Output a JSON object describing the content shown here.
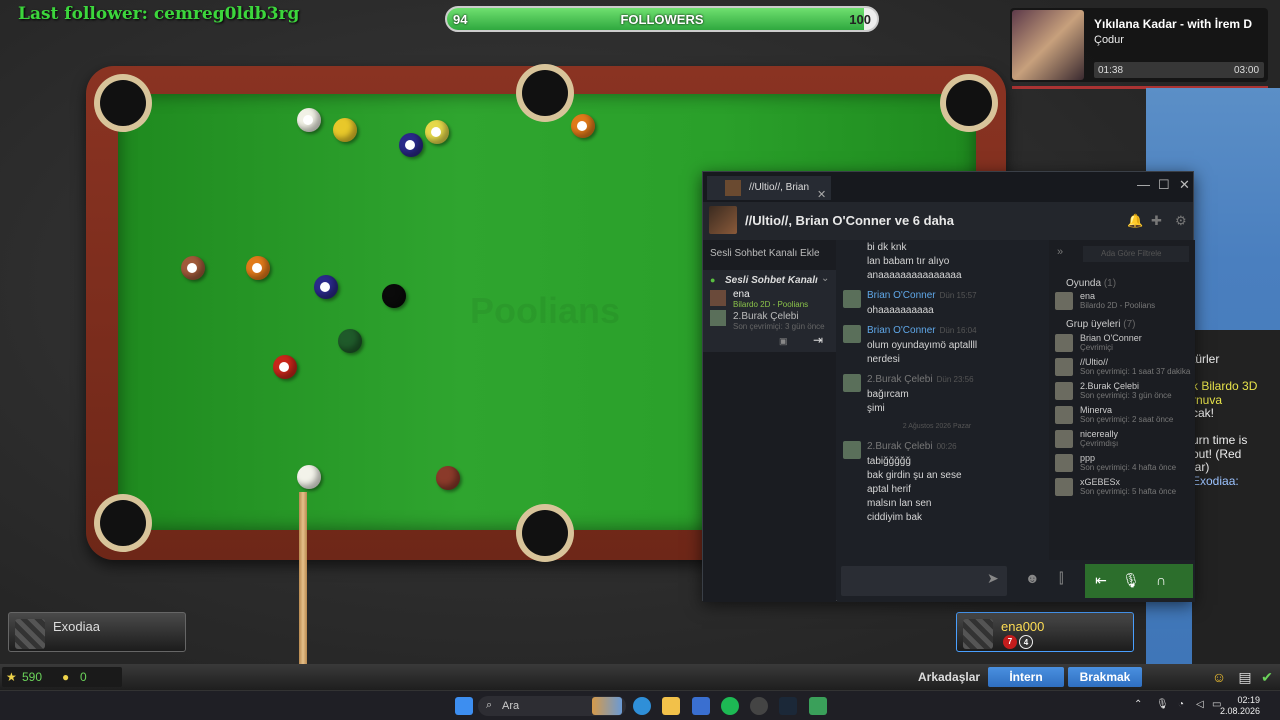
{
  "overlay": {
    "last_follower": "Last follower: cemreg0ldb3rg",
    "followers": {
      "min": "94",
      "label": "FOLLOWERS",
      "max": "100",
      "progress_fraction": 0.97
    }
  },
  "spotify": {
    "title": "Yıkılana Kadar - with İrem D",
    "artist": "Çodur",
    "elapsed": "01:38",
    "total": "03:00"
  },
  "table": {
    "watermark": "Poolians"
  },
  "players": {
    "left": {
      "name": "Exodiaa"
    },
    "right": {
      "name": "ena000",
      "chip1": "7",
      "chip2": "4"
    }
  },
  "gamebar": {
    "stars": "590",
    "coins": "0",
    "friends_label": "Arkadaşlar",
    "intern_button": "İntern",
    "quit_button": "Brakmak"
  },
  "stream_chat": {
    "lines": [
      {
        "text": "türler",
        "color": "w"
      },
      {
        "text": "]",
        "color": "g"
      },
      {
        "text": "k Bilardo 3D",
        "color": "y"
      },
      {
        "text": "rnuva",
        "color": "y"
      },
      {
        "text": "cak!",
        "color": "w"
      },
      {
        "text": "]",
        "color": "g"
      },
      {
        "text": "urn time is",
        "color": "w"
      },
      {
        "text": "out! (Red",
        "color": "w"
      },
      {
        "text": "lar)",
        "color": "w"
      },
      {
        "text": "Exodiaa:",
        "color": "b"
      }
    ]
  },
  "steam": {
    "tab_label": "//Ultio//, Brian",
    "header_title": "//Ultio//, Brian O'Conner ve 6 daha",
    "left": {
      "add_voice": "Sesli Sohbet Kanalı Ekle",
      "voice_channel": "Sesli Sohbet Kanalı",
      "users": [
        {
          "name": "ena",
          "status": "Bilardo 2D - Poolians"
        },
        {
          "name": "2.Burak Çelebi",
          "status": "Son çevrimiçi: 3 gün önce"
        }
      ]
    },
    "messages": [
      {
        "type": "line",
        "text": "bi dk knk"
      },
      {
        "type": "line",
        "text": "lan babam tır alıyo"
      },
      {
        "type": "line",
        "text": "anaaaaaaaaaaaaaaa"
      },
      {
        "type": "author",
        "name": "Brian O'Conner",
        "time": "Dün 15:57",
        "color": "blue"
      },
      {
        "type": "line",
        "text": "ohaaaaaaaaaa"
      },
      {
        "type": "author",
        "name": "Brian O'Conner",
        "time": "Dün 16:04",
        "color": "blue"
      },
      {
        "type": "line",
        "text": "olum oyundayımö aptallll"
      },
      {
        "type": "line",
        "text": "nerdesi"
      },
      {
        "type": "author",
        "name": "2.Burak Çelebi",
        "time": "Dün 23:56",
        "color": "gray"
      },
      {
        "type": "line",
        "text": "bağırcam"
      },
      {
        "type": "line",
        "text": "şimi"
      },
      {
        "type": "date",
        "text": "2 Ağustos 2026 Pazar"
      },
      {
        "type": "author",
        "name": "2.Burak Çelebi",
        "time": "00:26",
        "color": "gray"
      },
      {
        "type": "line",
        "text": "tabiğğğğğ"
      },
      {
        "type": "line",
        "text": "bak girdin şu an sese"
      },
      {
        "type": "line",
        "text": "aptal herif"
      },
      {
        "type": "line",
        "text": "malsın lan sen"
      },
      {
        "type": "line",
        "text": "ciddiyim bak"
      }
    ],
    "members": {
      "search_placeholder": "Ada Göre Filtrele",
      "in_game_heading": "Oyunda",
      "in_game_count": "(1)",
      "in_game": [
        {
          "name": "ena",
          "status": "Bilardo 2D - Poolians"
        }
      ],
      "group_heading": "Grup üyeleri",
      "group_count": "(7)",
      "group": [
        {
          "name": "Brian O'Conner",
          "status": "Çevrimiçi"
        },
        {
          "name": "//Ultio//",
          "status": "Son çevrimiçi: 1 saat 37 dakika"
        },
        {
          "name": "2.Burak Çelebi",
          "status": "Son çevrimiçi: 3 gün önce"
        },
        {
          "name": "Minerva",
          "status": "Son çevrimiçi: 2 saat önce"
        },
        {
          "name": "nicereally",
          "status": "Çevrimdışı"
        },
        {
          "name": "ppp",
          "status": "Son çevrimiçi: 4 hafta önce"
        },
        {
          "name": "xGEBESx",
          "status": "Son çevrimiçi: 5 hafta önce"
        }
      ]
    }
  },
  "taskbar": {
    "search": "Ara",
    "time": "02:19",
    "date": "2.08.2026"
  }
}
